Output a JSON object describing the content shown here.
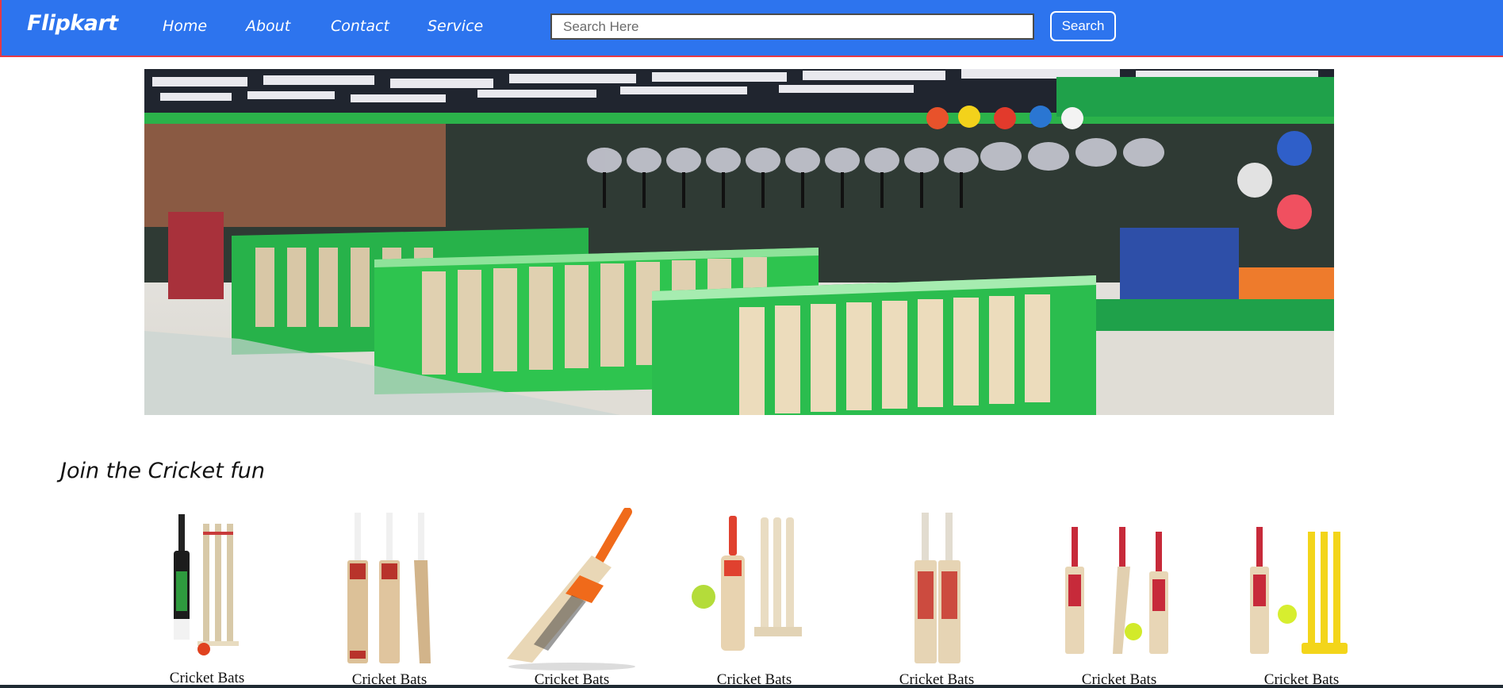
{
  "navbar": {
    "logo": "Flipkart",
    "links": [
      "Home",
      "About",
      "Contact",
      "Service"
    ],
    "search_placeholder": "Search Here",
    "search_value": "",
    "search_button": "Search",
    "colors": {
      "background": "#2d74ee",
      "border": "#e63946"
    }
  },
  "hero": {
    "image": "cricket-sports-store-photo"
  },
  "section": {
    "title": "Join the Cricket fun"
  },
  "products": [
    {
      "label": "Cricket Bats",
      "image": "cricket-bat-with-stumps-and-ball"
    },
    {
      "label": "Cricket Bats",
      "image": "three-cricket-bats"
    },
    {
      "label": "Cricket Bats",
      "image": "orange-handle-cricket-bat"
    },
    {
      "label": "Cricket Bats",
      "image": "cricket-bat-stumps-and-ball"
    },
    {
      "label": "Cricket Bats",
      "image": "two-cricket-bats"
    },
    {
      "label": "Cricket Bats",
      "image": "three-cricket-bats-with-ball"
    },
    {
      "label": "Cricket Bats",
      "image": "cricket-bat-with-yellow-stumps"
    }
  ]
}
